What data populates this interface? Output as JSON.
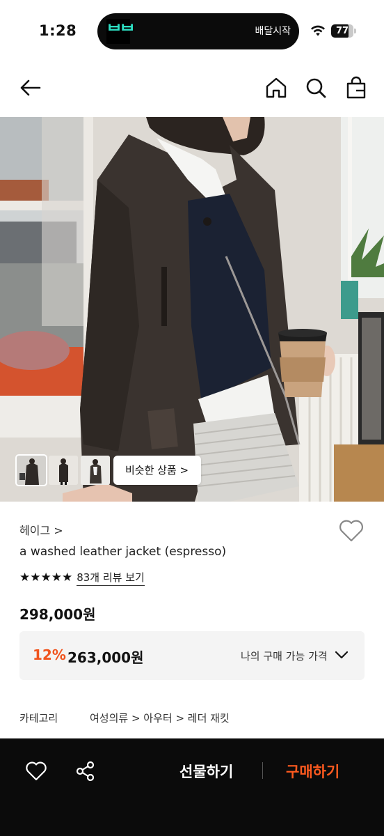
{
  "status_bar": {
    "time": "1:28",
    "island_app_icon": "baemin-icon",
    "island_text": "배달시작",
    "battery_level": 77,
    "battery_text": "77"
  },
  "nav": {
    "back_icon": "back-arrow-icon",
    "home_icon": "home-icon",
    "search_icon": "search-icon",
    "cart_icon": "shopping-bag-icon"
  },
  "gallery": {
    "similar_button_label": "비슷한 상품 >",
    "thumbnail_count": 3
  },
  "product": {
    "brand": "헤이그 >",
    "name": "a washed leather jacket (espresso)",
    "rating_stars": 5,
    "stars_text": "★★★★★",
    "review_link": "83개 리뷰 보기",
    "price": "298,000원"
  },
  "discount": {
    "rate": "12%",
    "price": "263,000원",
    "my_price_label": "나의 구매 가능 가격"
  },
  "category": {
    "label": "카테고리",
    "path": "여성의류 > 아우터 > 레더 재킷"
  },
  "bottom_bar": {
    "gift_label": "선물하기",
    "buy_label": "구매하기"
  },
  "colors": {
    "accent": "#ff5a1f",
    "discount": "#f0541e",
    "bottom_bar_bg": "#0b0b0b"
  }
}
